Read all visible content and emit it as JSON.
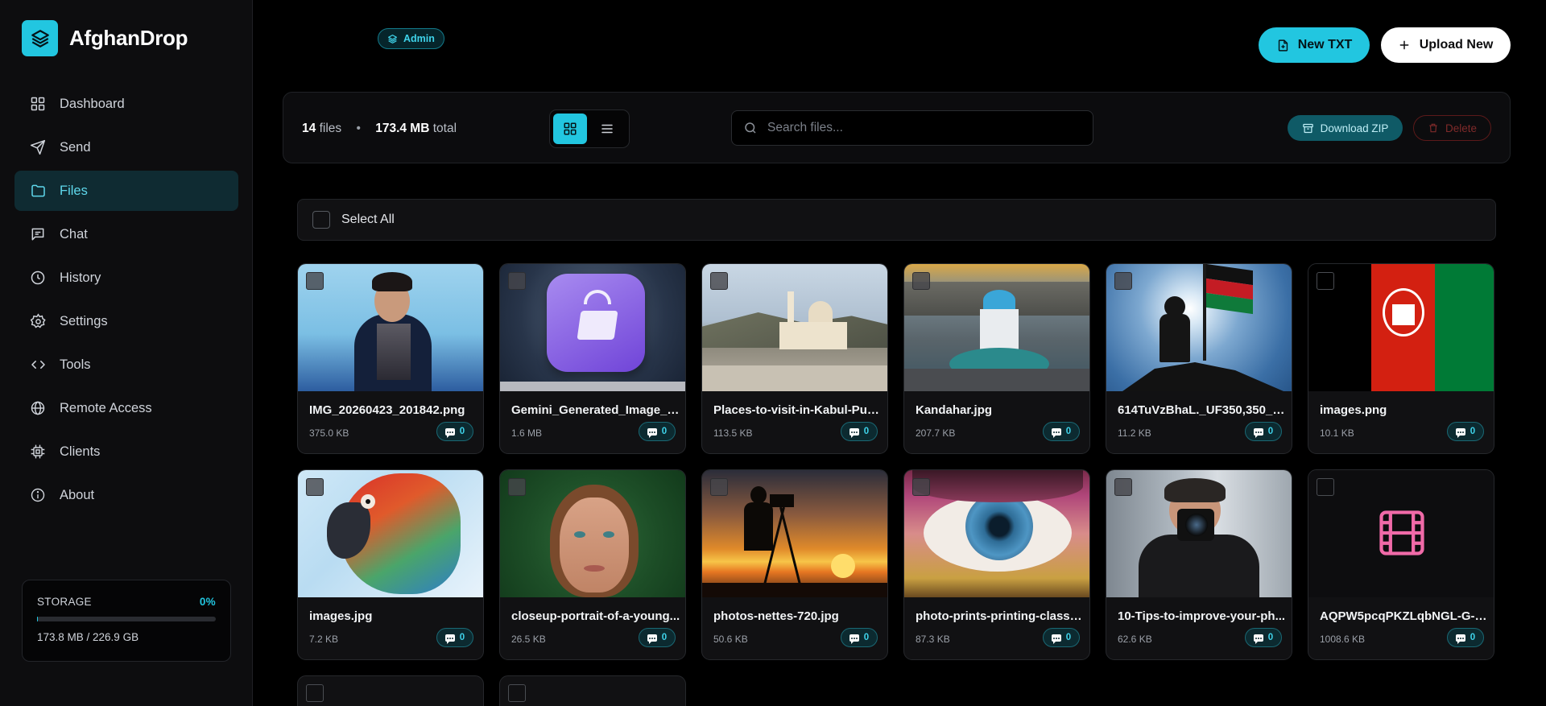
{
  "app": {
    "name": "AfghanDrop",
    "accent": "#22c6e0"
  },
  "sidebar": {
    "items": [
      {
        "label": "Dashboard",
        "icon": "grid-icon"
      },
      {
        "label": "Send",
        "icon": "send-icon"
      },
      {
        "label": "Files",
        "icon": "folder-icon",
        "active": true
      },
      {
        "label": "Chat",
        "icon": "chat-icon"
      },
      {
        "label": "History",
        "icon": "clock-icon"
      },
      {
        "label": "Settings",
        "icon": "gear-icon"
      },
      {
        "label": "Tools",
        "icon": "code-icon"
      },
      {
        "label": "Remote Access",
        "icon": "globe-icon"
      },
      {
        "label": "Clients",
        "icon": "chip-icon"
      },
      {
        "label": "About",
        "icon": "info-icon"
      }
    ],
    "storage": {
      "label": "STORAGE",
      "percent": "0%",
      "fill": 0.005,
      "usage": "173.8 MB / 226.9 GB"
    }
  },
  "header": {
    "badge": "Admin",
    "new_txt": "New TXT",
    "upload": "Upload New"
  },
  "toolbar": {
    "file_count": "14",
    "files_word": "files",
    "total_size": "173.4 MB",
    "total_word": "total",
    "view_mode": "grid",
    "search_placeholder": "Search files...",
    "download_zip": "Download ZIP",
    "delete": "Delete"
  },
  "select_all": "Select All",
  "files": [
    {
      "name": "IMG_20260423_201842.png",
      "size": "375.0 KB",
      "comments": "0"
    },
    {
      "name": "Gemini_Generated_Image_e0...",
      "size": "1.6 MB",
      "comments": "0"
    },
    {
      "name": "Places-to-visit-in-Kabul-Pul-...",
      "size": "113.5 KB",
      "comments": "0"
    },
    {
      "name": "Kandahar.jpg",
      "size": "207.7 KB",
      "comments": "0"
    },
    {
      "name": "614TuVzBhaL._UF350,350_QL...",
      "size": "11.2 KB",
      "comments": "0"
    },
    {
      "name": "images.png",
      "size": "10.1 KB",
      "comments": "0"
    },
    {
      "name": "images.jpg",
      "size": "7.2 KB",
      "comments": "0"
    },
    {
      "name": "closeup-portrait-of-a-young...",
      "size": "26.5 KB",
      "comments": "0"
    },
    {
      "name": "photos-nettes-720.jpg",
      "size": "50.6 KB",
      "comments": "0"
    },
    {
      "name": "photo-prints-printing-classic...",
      "size": "87.3 KB",
      "comments": "0"
    },
    {
      "name": "10-Tips-to-improve-your-ph...",
      "size": "62.6 KB",
      "comments": "0"
    },
    {
      "name": "AQPW5pcqPKZLqbNGL-G-X...",
      "size": "1008.6 KB",
      "comments": "0"
    }
  ]
}
